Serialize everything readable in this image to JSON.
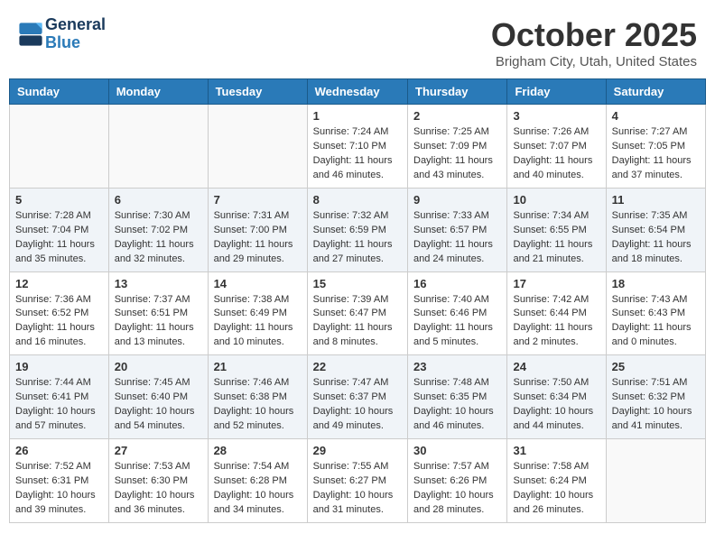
{
  "header": {
    "logo_line1": "General",
    "logo_line2": "Blue",
    "month": "October 2025",
    "location": "Brigham City, Utah, United States"
  },
  "days_of_week": [
    "Sunday",
    "Monday",
    "Tuesday",
    "Wednesday",
    "Thursday",
    "Friday",
    "Saturday"
  ],
  "weeks": [
    [
      {
        "day": "",
        "content": ""
      },
      {
        "day": "",
        "content": ""
      },
      {
        "day": "",
        "content": ""
      },
      {
        "day": "1",
        "content": "Sunrise: 7:24 AM\nSunset: 7:10 PM\nDaylight: 11 hours\nand 46 minutes."
      },
      {
        "day": "2",
        "content": "Sunrise: 7:25 AM\nSunset: 7:09 PM\nDaylight: 11 hours\nand 43 minutes."
      },
      {
        "day": "3",
        "content": "Sunrise: 7:26 AM\nSunset: 7:07 PM\nDaylight: 11 hours\nand 40 minutes."
      },
      {
        "day": "4",
        "content": "Sunrise: 7:27 AM\nSunset: 7:05 PM\nDaylight: 11 hours\nand 37 minutes."
      }
    ],
    [
      {
        "day": "5",
        "content": "Sunrise: 7:28 AM\nSunset: 7:04 PM\nDaylight: 11 hours\nand 35 minutes."
      },
      {
        "day": "6",
        "content": "Sunrise: 7:30 AM\nSunset: 7:02 PM\nDaylight: 11 hours\nand 32 minutes."
      },
      {
        "day": "7",
        "content": "Sunrise: 7:31 AM\nSunset: 7:00 PM\nDaylight: 11 hours\nand 29 minutes."
      },
      {
        "day": "8",
        "content": "Sunrise: 7:32 AM\nSunset: 6:59 PM\nDaylight: 11 hours\nand 27 minutes."
      },
      {
        "day": "9",
        "content": "Sunrise: 7:33 AM\nSunset: 6:57 PM\nDaylight: 11 hours\nand 24 minutes."
      },
      {
        "day": "10",
        "content": "Sunrise: 7:34 AM\nSunset: 6:55 PM\nDaylight: 11 hours\nand 21 minutes."
      },
      {
        "day": "11",
        "content": "Sunrise: 7:35 AM\nSunset: 6:54 PM\nDaylight: 11 hours\nand 18 minutes."
      }
    ],
    [
      {
        "day": "12",
        "content": "Sunrise: 7:36 AM\nSunset: 6:52 PM\nDaylight: 11 hours\nand 16 minutes."
      },
      {
        "day": "13",
        "content": "Sunrise: 7:37 AM\nSunset: 6:51 PM\nDaylight: 11 hours\nand 13 minutes."
      },
      {
        "day": "14",
        "content": "Sunrise: 7:38 AM\nSunset: 6:49 PM\nDaylight: 11 hours\nand 10 minutes."
      },
      {
        "day": "15",
        "content": "Sunrise: 7:39 AM\nSunset: 6:47 PM\nDaylight: 11 hours\nand 8 minutes."
      },
      {
        "day": "16",
        "content": "Sunrise: 7:40 AM\nSunset: 6:46 PM\nDaylight: 11 hours\nand 5 minutes."
      },
      {
        "day": "17",
        "content": "Sunrise: 7:42 AM\nSunset: 6:44 PM\nDaylight: 11 hours\nand 2 minutes."
      },
      {
        "day": "18",
        "content": "Sunrise: 7:43 AM\nSunset: 6:43 PM\nDaylight: 11 hours\nand 0 minutes."
      }
    ],
    [
      {
        "day": "19",
        "content": "Sunrise: 7:44 AM\nSunset: 6:41 PM\nDaylight: 10 hours\nand 57 minutes."
      },
      {
        "day": "20",
        "content": "Sunrise: 7:45 AM\nSunset: 6:40 PM\nDaylight: 10 hours\nand 54 minutes."
      },
      {
        "day": "21",
        "content": "Sunrise: 7:46 AM\nSunset: 6:38 PM\nDaylight: 10 hours\nand 52 minutes."
      },
      {
        "day": "22",
        "content": "Sunrise: 7:47 AM\nSunset: 6:37 PM\nDaylight: 10 hours\nand 49 minutes."
      },
      {
        "day": "23",
        "content": "Sunrise: 7:48 AM\nSunset: 6:35 PM\nDaylight: 10 hours\nand 46 minutes."
      },
      {
        "day": "24",
        "content": "Sunrise: 7:50 AM\nSunset: 6:34 PM\nDaylight: 10 hours\nand 44 minutes."
      },
      {
        "day": "25",
        "content": "Sunrise: 7:51 AM\nSunset: 6:32 PM\nDaylight: 10 hours\nand 41 minutes."
      }
    ],
    [
      {
        "day": "26",
        "content": "Sunrise: 7:52 AM\nSunset: 6:31 PM\nDaylight: 10 hours\nand 39 minutes."
      },
      {
        "day": "27",
        "content": "Sunrise: 7:53 AM\nSunset: 6:30 PM\nDaylight: 10 hours\nand 36 minutes."
      },
      {
        "day": "28",
        "content": "Sunrise: 7:54 AM\nSunset: 6:28 PM\nDaylight: 10 hours\nand 34 minutes."
      },
      {
        "day": "29",
        "content": "Sunrise: 7:55 AM\nSunset: 6:27 PM\nDaylight: 10 hours\nand 31 minutes."
      },
      {
        "day": "30",
        "content": "Sunrise: 7:57 AM\nSunset: 6:26 PM\nDaylight: 10 hours\nand 28 minutes."
      },
      {
        "day": "31",
        "content": "Sunrise: 7:58 AM\nSunset: 6:24 PM\nDaylight: 10 hours\nand 26 minutes."
      },
      {
        "day": "",
        "content": ""
      }
    ]
  ]
}
